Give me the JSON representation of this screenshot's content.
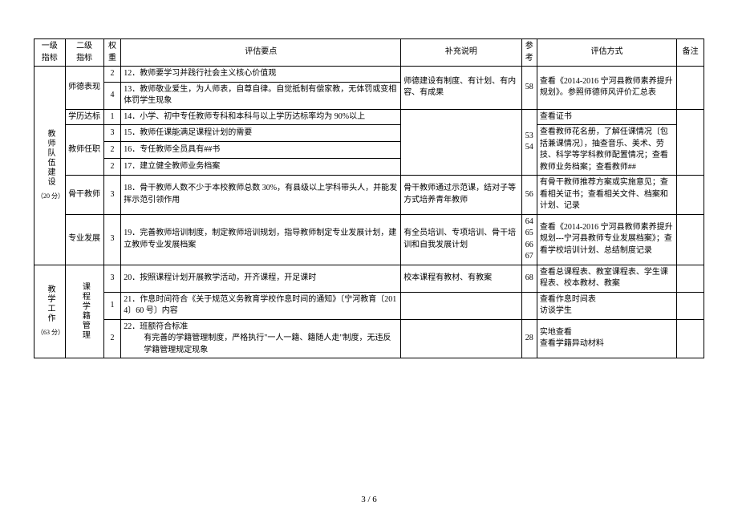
{
  "headers": {
    "l1": "一级\n指标",
    "l2": "二级\n指标",
    "wt": "权\n重",
    "pt": "评估要点",
    "sp": "补充说明",
    "rf": "参\n考",
    "mt": "评估方式",
    "rm": "备注"
  },
  "groups": [
    {
      "l1": "教师队伍建设",
      "l1pts": "（20 分）",
      "subs": [
        {
          "l2": "师德表现",
          "rows": [
            {
              "wt": "2",
              "pt": "12．教师要学习并践行社会主义核心价值观",
              "sp": "师德建设有制度、有计划、有内容、有成果",
              "rf": "58",
              "mt": "查看《2014-2016 宁河县教师素养提升规划》。参照师德师风评价汇总表"
            },
            {
              "wt": "4",
              "pt": "13．教师敬业爱生，为人师表，自尊自律。自觉抵制有偿家教，无体罚或变相体罚学生现象"
            }
          ]
        },
        {
          "l2": "学历达标",
          "rows": [
            {
              "wt": "1",
              "pt": "14．小学、初中专任教师专科和本科与以上学历达标率均为 90%以上",
              "mt": "查看证书"
            }
          ]
        },
        {
          "l2": "教师任职",
          "rows": [
            {
              "wt": "3",
              "pt": "15．教师任课能满足课程计划的需要",
              "rf": "53\n54",
              "mt": "查看教师花名册，了解任课情况〔包括兼课情况〕，抽查音乐、美术、劳技、科学等学科教师配置情况；查看教师业务档案；查看教师##"
            },
            {
              "wt": "2",
              "pt": "16．专任教师全员具有##书"
            },
            {
              "wt": "2",
              "pt": "17．建立健全教师业务档案"
            }
          ]
        },
        {
          "l2": "骨干教师",
          "rows": [
            {
              "wt": "3",
              "pt": "18．骨干教师人数不少于本校教师总数 30%，有县级以上学科带头人，并能发挥示范引领作用",
              "sp": "骨干教师通过示范课，结对子等方式培养青年教师",
              "rf": "56",
              "mt": "有骨干教师推荐方案或实施意见；查看相关证书；查看相关文件、档案和计划、记录"
            }
          ]
        },
        {
          "l2": "专业发展",
          "rows": [
            {
              "wt": "3",
              "pt": "19．完善教师培训制度，制定教师培训规划，指导教师制定专业发展计划，建立教师专业发展档案",
              "sp": "有全员培训、专项培训、骨干培训和自我发展计划",
              "rf": "64\n65\n66\n67",
              "mt": "查看《2014-2016 宁河县教师素养提升规划---宁河县教师专业发展档案》；查看学校培训计划、总结制度记录"
            }
          ]
        }
      ]
    },
    {
      "l1": "教学工作",
      "l1pts": "（63 分）",
      "subs": [
        {
          "l2": "课程学籍管理",
          "rows": [
            {
              "wt": "3",
              "pt": "20．按照课程计划开展教学活动，开齐课程，开足课时",
              "sp": "校本课程有教材、有教案",
              "rf": "68",
              "mt": "查看总课程表、教室课程表、学生课程表、校本教材、教案"
            },
            {
              "wt": "1",
              "pt": "21．作息时间符合《关于规范义务教育学校作息时间的通知》〔宁河教育〔2014〕60 号〕内容",
              "mt": "查看作息时间表\n访谈学生"
            },
            {
              "wt": "2",
              "pt": "22．班额符合标准",
              "pt2": "有完善的学籍管理制度，严格执行\"一人一籍、籍随人走\"制度，无违反学籍管理规定现象",
              "rf": "28",
              "mt": "实地查看\n查看学籍异动材料"
            }
          ]
        }
      ]
    }
  ],
  "pagenum": "3 / 6"
}
